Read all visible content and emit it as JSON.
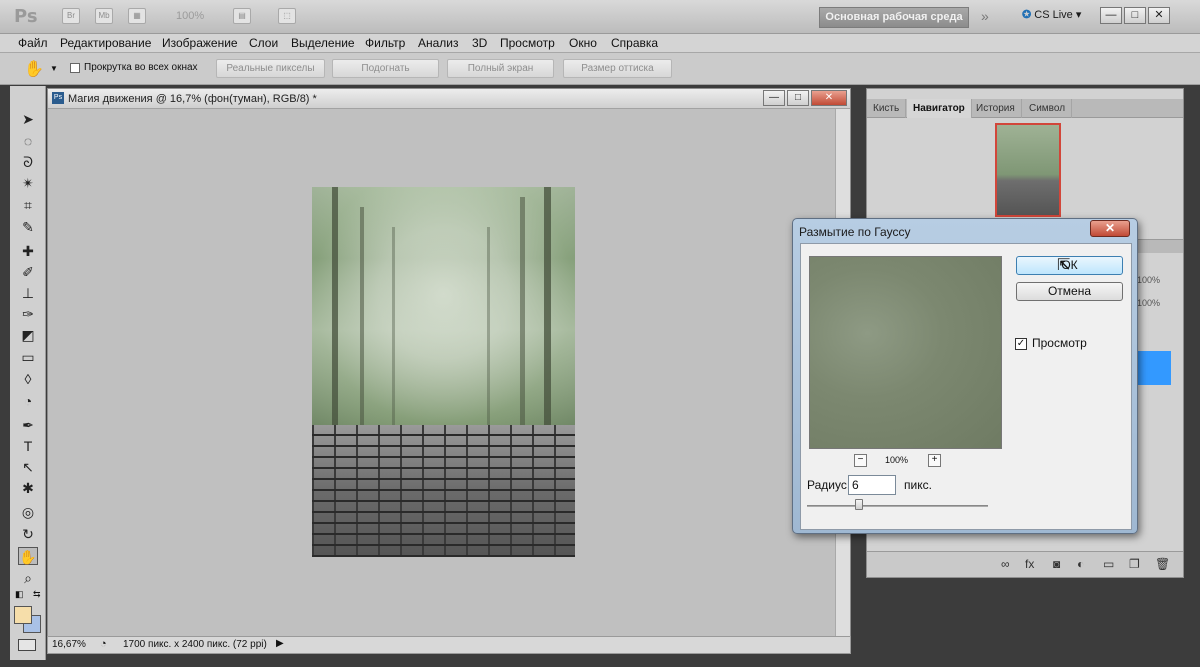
{
  "app": {
    "logo": "Ps",
    "bridge_button": "Br",
    "minibridge_button": "Mb",
    "zoom": "100%",
    "workspace": "Основная рабочая среда",
    "workspace_more": "»",
    "cs_live": "CS Live",
    "window_controls": [
      "—",
      "□",
      "✕"
    ]
  },
  "menu": [
    "Файл",
    "Редактирование",
    "Изображение",
    "Слои",
    "Выделение",
    "Фильтр",
    "Анализ",
    "3D",
    "Просмотр",
    "Окно",
    "Справка"
  ],
  "options": {
    "scroll_all": "Прокрутка во всех окнах",
    "buttons": [
      "Реальные пикселы",
      "Подогнать",
      "Полный экран",
      "Размер оттиска"
    ]
  },
  "document": {
    "title": "Магия движения @ 16,7% (фон(туман), RGB/8) *",
    "zoom": "16,67%",
    "info": "1700 пикс. x 2400 пикс. (72 ppi)"
  },
  "panel": {
    "tabs": [
      "Кисть",
      "Навигатор",
      "История",
      "Символ"
    ],
    "active_tab": "Навигатор",
    "percent_1": "100%",
    "percent_2": "100%"
  },
  "dialog": {
    "title": "Размытие по Гауссу",
    "ok": "ОК",
    "cancel": "Отмена",
    "preview_label": "Просмотр",
    "preview_checked": true,
    "zoom": "100%",
    "zoom_out": "−",
    "zoom_in": "+",
    "radius_label": "Радиус:",
    "radius_value": "6",
    "radius_unit": "пикс.",
    "close": "✕"
  },
  "colors": {
    "foreground": "#f6deaa",
    "background": "#a9c1e6",
    "selection_blue": "#3399ff"
  }
}
